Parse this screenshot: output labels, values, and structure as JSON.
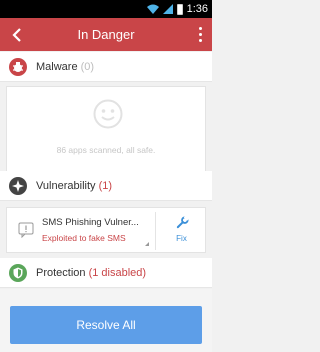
{
  "status_bar": {
    "time": "1:36"
  },
  "app_bar": {
    "title": "In Danger"
  },
  "sections": {
    "malware": {
      "label": "Malware",
      "count": "(0)"
    },
    "vulnerability": {
      "label": "Vulnerability",
      "count": "(1)"
    },
    "protection": {
      "label": "Protection",
      "count": "(1 disabled)"
    }
  },
  "malware_card": {
    "message": "86 apps scanned, all safe."
  },
  "vulnerability_item": {
    "title": "SMS Phishing Vulner...",
    "subtitle": "Exploited to fake SMS",
    "action_label": "Fix"
  },
  "resolve_button": {
    "label": "Resolve All"
  },
  "colors": {
    "header_red": "#c94548",
    "accent_blue": "#5d9ee8",
    "link_blue": "#3a8fd8"
  },
  "icons": [
    "wifi-icon",
    "cell-signal-icon",
    "battery-icon",
    "back-arrow-icon",
    "overflow-menu-icon",
    "malware-bug-icon",
    "smiley-icon",
    "vulnerability-icon",
    "sms-warning-icon",
    "wrench-icon",
    "shield-icon"
  ]
}
